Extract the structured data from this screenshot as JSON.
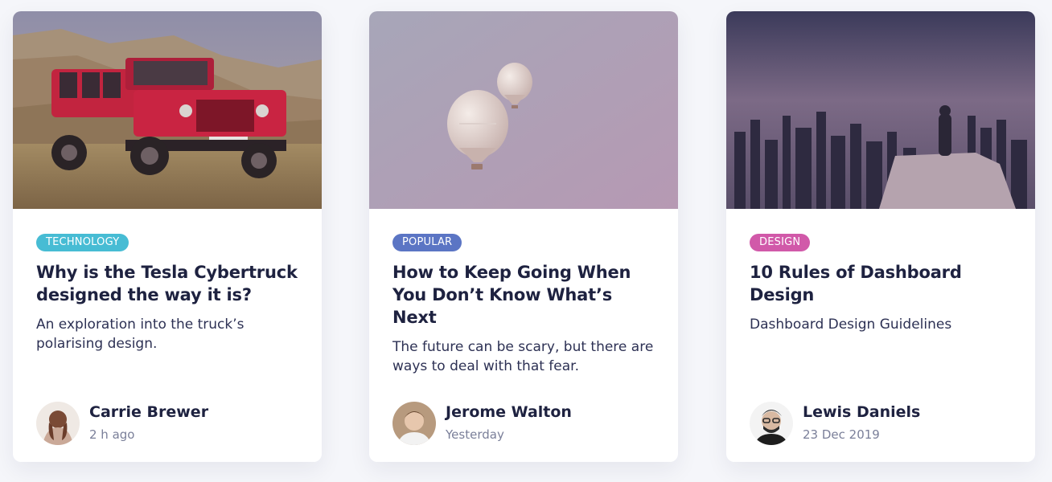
{
  "cards": [
    {
      "image_alt": "red jeep in mountain landscape",
      "tag": "TECHNOLOGY",
      "tag_color": "#47bcd4",
      "title": "Why is the Tesla Cybertruck designed the way it is?",
      "description": "An exploration into the truck’s polarising design.",
      "author": "Carrie Brewer",
      "date": "2 h ago"
    },
    {
      "image_alt": "hot air balloons in hazy sky",
      "tag": "POPULAR",
      "tag_color": "#5b75c4",
      "title": "How to Keep Going When You Don’t Know What’s Next",
      "description": "The future can be scary, but there are ways to deal with that fear.",
      "author": "Jerome Walton",
      "date": "Yesterday"
    },
    {
      "image_alt": "person overlooking city skyline at dusk",
      "tag": "DESIGN",
      "tag_color": "#d159a9",
      "title": "10 Rules of Dashboard Design",
      "description": "Dashboard Design Guidelines",
      "author": "Lewis Daniels",
      "date": "23 Dec 2019"
    }
  ]
}
